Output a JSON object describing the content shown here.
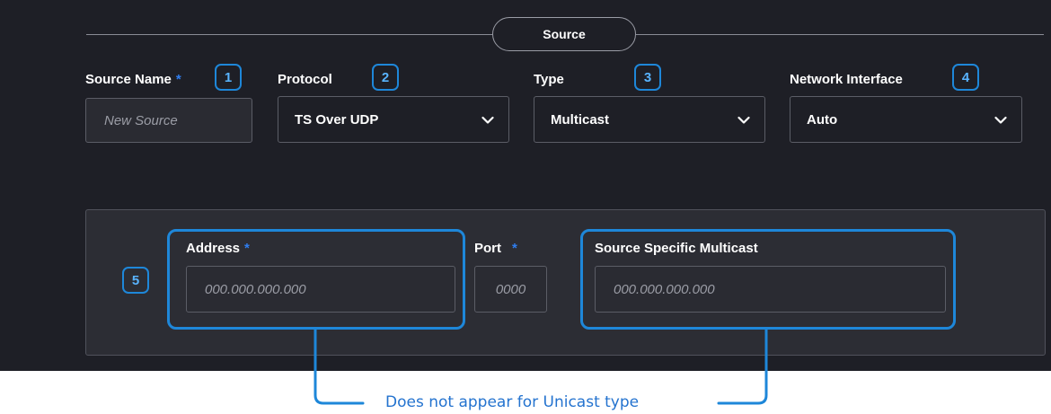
{
  "section": {
    "title": "Source"
  },
  "fields": {
    "source_name": {
      "label": "Source Name",
      "required": "*",
      "placeholder": "New Source",
      "badge": "1"
    },
    "protocol": {
      "label": "Protocol",
      "value": "TS Over UDP",
      "badge": "2"
    },
    "type": {
      "label": "Type",
      "value": "Multicast",
      "badge": "3"
    },
    "network_interface": {
      "label": "Network Interface",
      "value": "Auto",
      "badge": "4"
    }
  },
  "multicast": {
    "badge": "5",
    "address": {
      "label": "Address",
      "required": "*",
      "placeholder": "000.000.000.000"
    },
    "port": {
      "label": "Port",
      "required": "*",
      "placeholder": "0000"
    },
    "ssm": {
      "label": "Source Specific Multicast",
      "placeholder": "000.000.000.000"
    }
  },
  "annotation": {
    "text": "Does not appear for Unicast type"
  },
  "icons": {
    "dropdown": "chevron-down-icon"
  },
  "colors": {
    "panel_bg": "#1e1f26",
    "subpanel_bg": "#2c2d34",
    "accent_blue": "#1e87d9",
    "required_star": "#2f7ef0",
    "annotation_text": "#2473cf"
  }
}
